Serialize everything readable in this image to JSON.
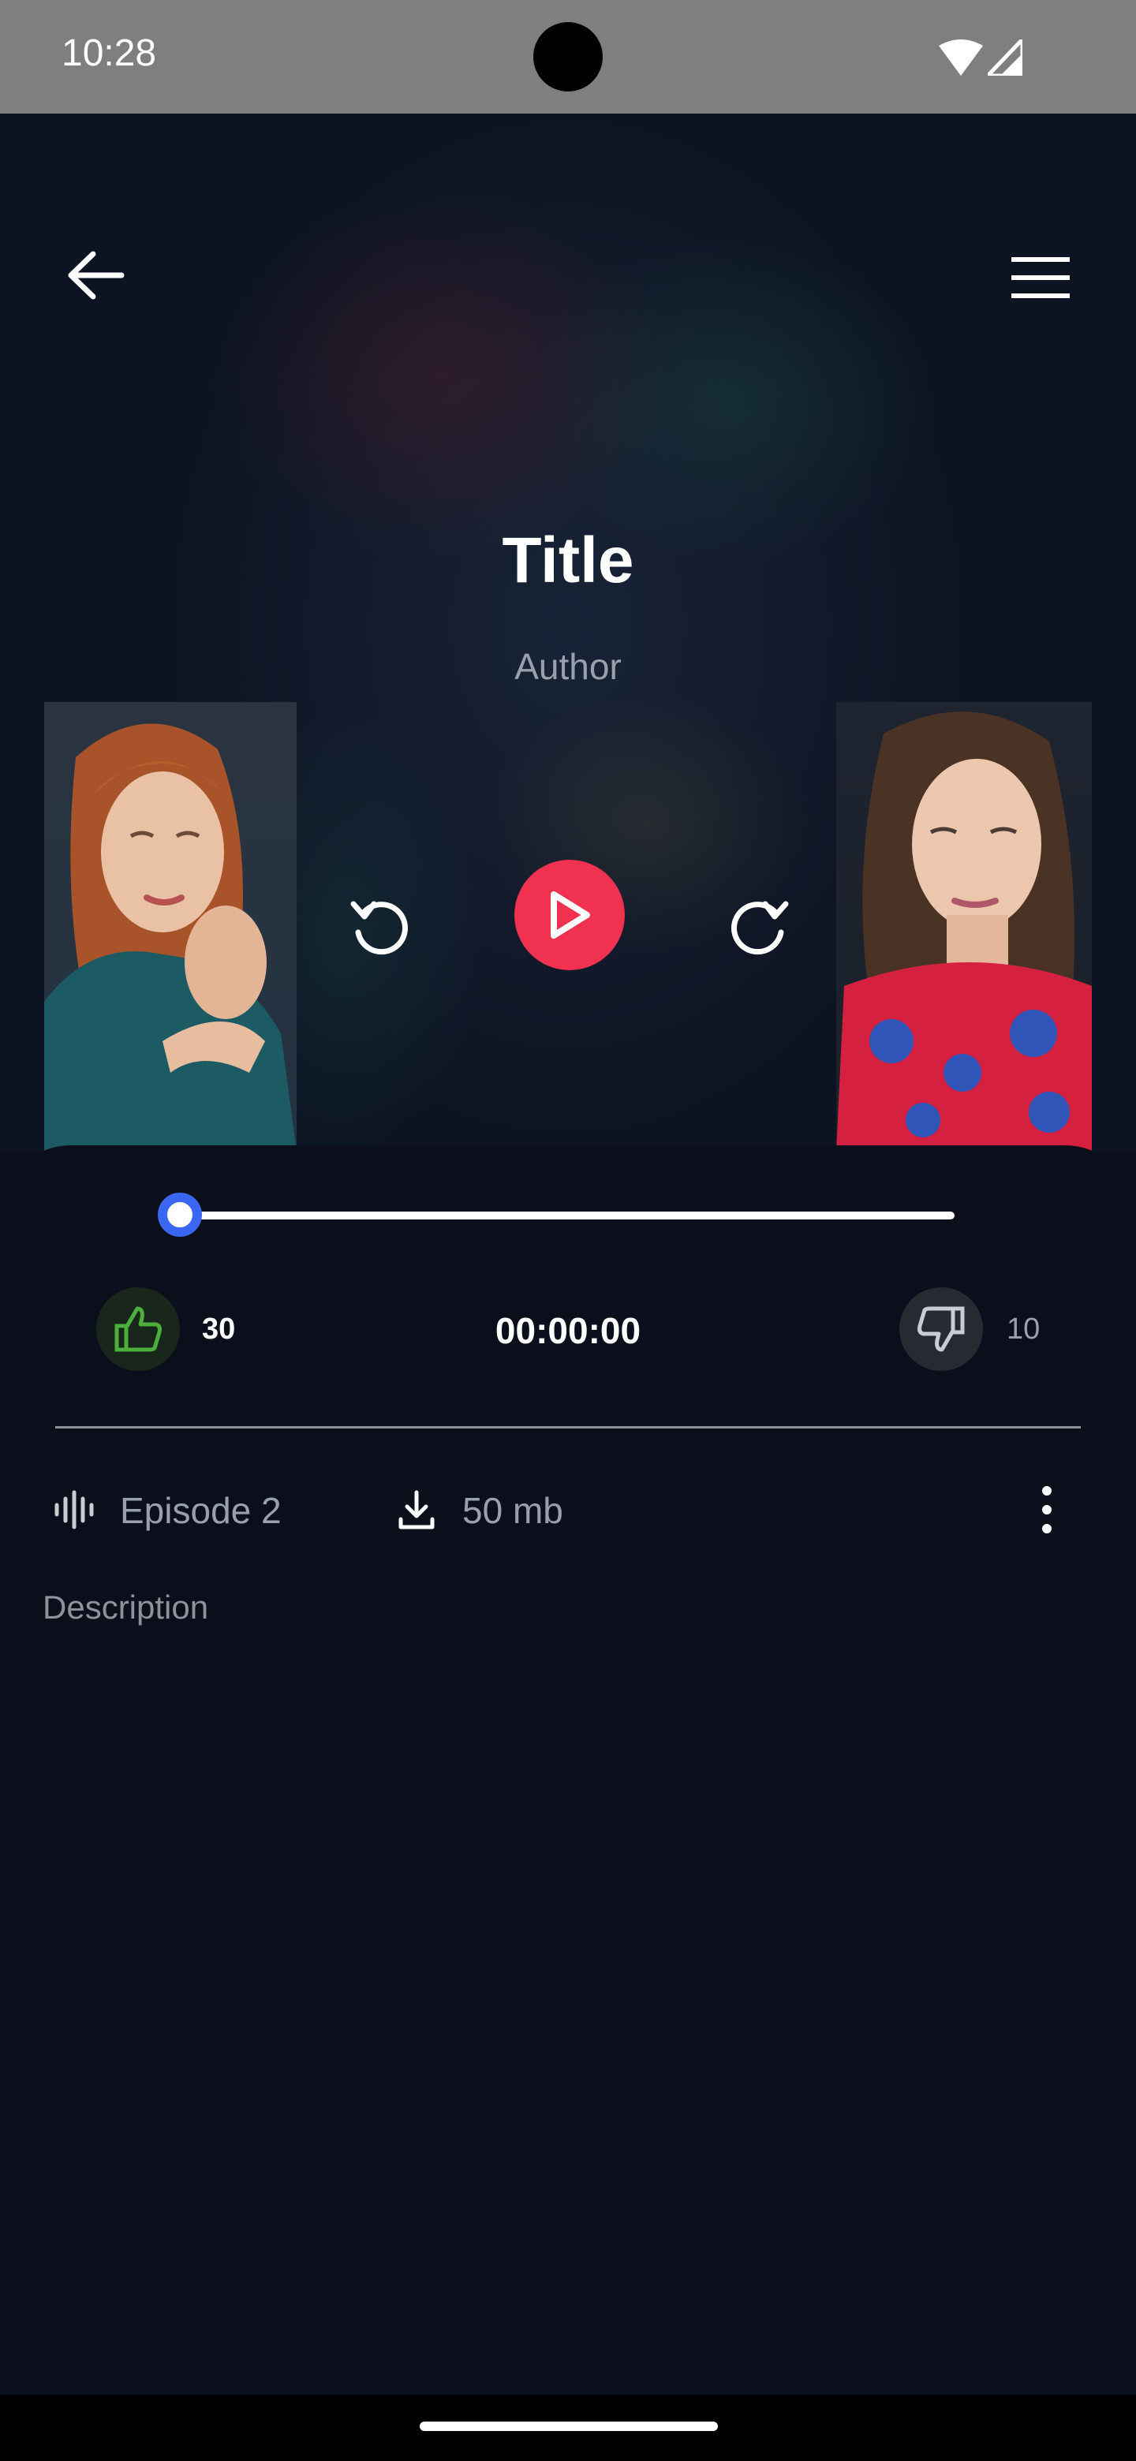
{
  "status_bar": {
    "time": "10:28"
  },
  "header": {
    "back_icon": "arrow-left-icon",
    "menu_icon": "hamburger-menu-icon"
  },
  "episode": {
    "title": "Title",
    "author": "Author"
  },
  "player": {
    "rewind_icon": "rewind-icon",
    "play_icon": "play-icon",
    "forward_icon": "forward-icon",
    "play_color": "#f0314f",
    "progress": 0,
    "progress_color": "#3a66f2",
    "time": "00:00:00"
  },
  "reactions": {
    "likes": "30",
    "dislikes": "10",
    "like_color": "#4caf3c"
  },
  "meta": {
    "episode_label": "Episode 2",
    "size_label": "50 mb"
  },
  "description": "Description"
}
